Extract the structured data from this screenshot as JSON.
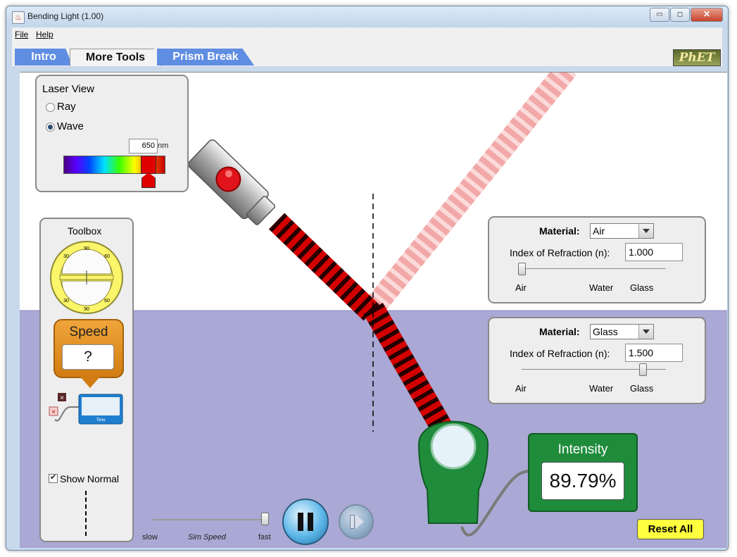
{
  "window": {
    "title": "Bending Light (1.00)",
    "minimize_glyph": "▭",
    "restore_glyph": "◻",
    "close_glyph": "✕",
    "app_icon": "java-cup-icon"
  },
  "menu": {
    "file": "File",
    "help": "Help"
  },
  "tabs": [
    {
      "label": "Intro"
    },
    {
      "label": "More Tools"
    },
    {
      "label": "Prism Break"
    }
  ],
  "logo": "PhET",
  "laser_view": {
    "title": "Laser View",
    "options": [
      {
        "label": "Ray",
        "selected": false
      },
      {
        "label": "Wave",
        "selected": true
      }
    ],
    "wavelength_value": "650",
    "wavelength_unit": "nm"
  },
  "toolbox": {
    "title": "Toolbox",
    "protractor_labels": [
      "30",
      "60",
      "90",
      "90",
      "60",
      "30"
    ],
    "speed_label": "Speed",
    "speed_value": "?",
    "time_label": "Time",
    "show_normal_label": "Show Normal",
    "show_normal_checked": true
  },
  "material_top": {
    "material_label": "Material:",
    "material_value": "Air",
    "index_label": "Index of Refraction (n):",
    "index_value": "1.000",
    "slider_labels": [
      "Air",
      "Water",
      "Glass"
    ],
    "slider_position": 0.0
  },
  "material_bottom": {
    "material_label": "Material:",
    "material_value": "Glass",
    "index_label": "Index of Refraction (n):",
    "index_value": "1.500",
    "slider_labels": [
      "Air",
      "Water",
      "Glass"
    ],
    "slider_position": 0.85
  },
  "intensity": {
    "label": "Intensity",
    "value": "89.79%"
  },
  "sim_speed": {
    "slow": "slow",
    "label": "Sim Speed",
    "fast": "fast",
    "position": 0.98
  },
  "controls": {
    "pause_icon": "pause-icon",
    "step_icon": "step-forward-icon"
  },
  "reset_all": "Reset All",
  "colors": {
    "medium_bottom": "#aaa8d4",
    "beam": "#d40000",
    "tab_blue": "#5f8de2",
    "intensity_green": "#1f8c3c",
    "reset_yellow": "#ffff40"
  }
}
